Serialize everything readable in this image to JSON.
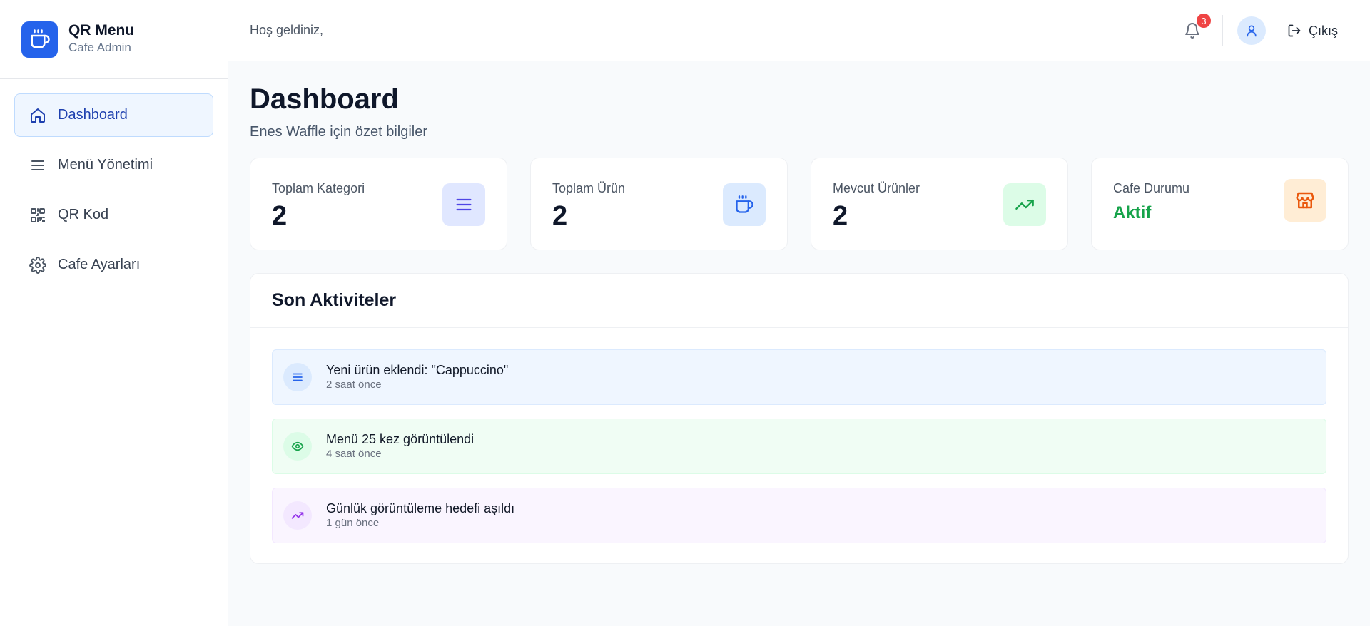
{
  "brand": {
    "title": "QR Menu",
    "subtitle": "Cafe Admin",
    "accent": "#2563eb"
  },
  "sidebar": {
    "items": [
      {
        "label": "Dashboard",
        "icon": "home-icon",
        "active": true
      },
      {
        "label": "Menü Yönetimi",
        "icon": "menu-lines-icon",
        "active": false
      },
      {
        "label": "QR Kod",
        "icon": "qr-code-icon",
        "active": false
      },
      {
        "label": "Cafe Ayarları",
        "icon": "gear-icon",
        "active": false
      }
    ]
  },
  "header": {
    "welcome": "Hoş geldiniz,",
    "notification_count": "3",
    "logout_label": "Çıkış"
  },
  "page": {
    "title": "Dashboard",
    "subtitle": "Enes Waffle için özet bilgiler"
  },
  "stats": [
    {
      "label": "Toplam Kategori",
      "value": "2",
      "icon": "list-icon",
      "color": "#4f46e5"
    },
    {
      "label": "Toplam Ürün",
      "value": "2",
      "icon": "coffee-icon",
      "color": "#2563eb"
    },
    {
      "label": "Mevcut Ürünler",
      "value": "2",
      "icon": "trending-up-icon",
      "color": "#16a34a"
    },
    {
      "label": "Cafe Durumu",
      "value": "Aktif",
      "icon": "store-icon",
      "color": "#ea580c"
    }
  ],
  "activity": {
    "title": "Son Aktiviteler",
    "items": [
      {
        "title": "Yeni ürün eklendi: \"Cappuccino\"",
        "time": "2 saat önce",
        "icon": "list-icon",
        "color": "#2563eb"
      },
      {
        "title": "Menü 25 kez görüntülendi",
        "time": "4 saat önce",
        "icon": "eye-icon",
        "color": "#16a34a"
      },
      {
        "title": "Günlük görüntüleme hedefi aşıldı",
        "time": "1 gün önce",
        "icon": "trending-up-icon",
        "color": "#9333ea"
      }
    ]
  }
}
